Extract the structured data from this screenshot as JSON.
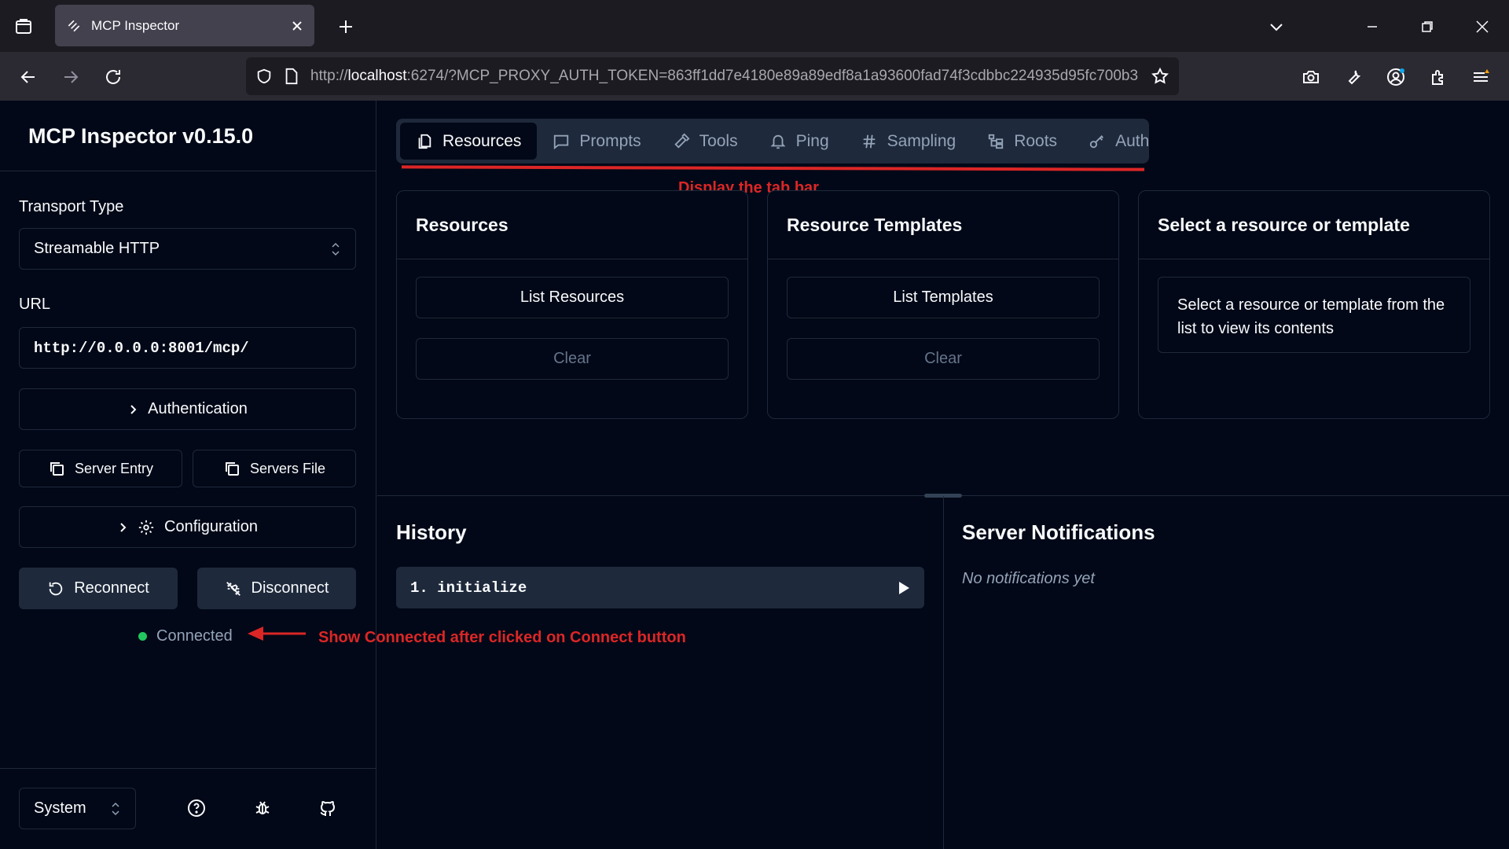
{
  "browser": {
    "tab_title": "MCP Inspector",
    "url_host_prefix": "http://",
    "url_host": "localhost",
    "url_rest": ":6274/?MCP_PROXY_AUTH_TOKEN=863ff1dd7e4180e89a89edf8a1a93600fad74f3cdbbc224935d95fc700b3"
  },
  "sidebar": {
    "title": "MCP Inspector v0.15.0",
    "transport_label": "Transport Type",
    "transport_value": "Streamable HTTP",
    "url_label": "URL",
    "url_value": "http://0.0.0.0:8001/mcp/",
    "authentication": "Authentication",
    "server_entry": "Server Entry",
    "servers_file": "Servers File",
    "configuration": "Configuration",
    "reconnect": "Reconnect",
    "disconnect": "Disconnect",
    "status": "Connected",
    "status_color": "#22c55e",
    "theme": "System"
  },
  "tabs": [
    {
      "label": "Resources",
      "icon": "files-icon",
      "active": true
    },
    {
      "label": "Prompts",
      "icon": "message-icon"
    },
    {
      "label": "Tools",
      "icon": "hammer-icon"
    },
    {
      "label": "Ping",
      "icon": "bell-icon"
    },
    {
      "label": "Sampling",
      "icon": "hash-icon"
    },
    {
      "label": "Roots",
      "icon": "folder-tree-icon"
    },
    {
      "label": "Auth",
      "icon": "key-icon"
    }
  ],
  "panels": {
    "resources": {
      "title": "Resources",
      "list_button": "List Resources",
      "clear_button": "Clear"
    },
    "templates": {
      "title": "Resource Templates",
      "list_button": "List Templates",
      "clear_button": "Clear"
    },
    "detail": {
      "title": "Select a resource or template",
      "message": "Select a resource or template from the list to view its contents"
    }
  },
  "history": {
    "title": "History",
    "items": [
      "1. initialize"
    ]
  },
  "notifications": {
    "title": "Server Notifications",
    "empty": "No notifications yet"
  },
  "annotations": {
    "tab_bar": "Display the tab bar",
    "connected": "Show Connected after clicked on Connect button",
    "color": "#dc2626"
  }
}
